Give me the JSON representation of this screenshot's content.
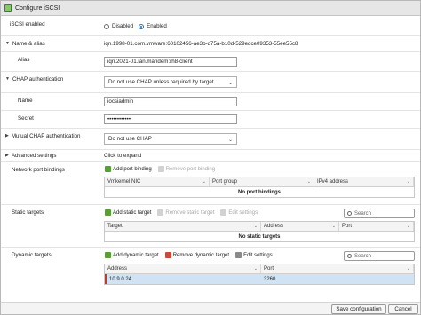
{
  "window": {
    "title": "Configure iSCSI"
  },
  "iscsi_enabled": {
    "label": "iSCSI enabled",
    "option_disabled": "Disabled",
    "option_enabled": "Enabled",
    "selected": "Enabled"
  },
  "name_alias": {
    "label": "Name & alias",
    "iqn": "iqn.1998-01.com.vmware:60102456-ae3b-d75a-b10d-529edce09353-55ee55c8"
  },
  "alias": {
    "label": "Alias",
    "value": "iqn.2021-01.lan.mandem:rh8-client"
  },
  "chap": {
    "label": "CHAP authentication",
    "value": "Do not use CHAP unless required by target"
  },
  "chap_name": {
    "label": "Name",
    "value": "iocsiadmin"
  },
  "chap_secret": {
    "label": "Secret",
    "value": "••••••••••••"
  },
  "mutual_chap": {
    "label": "Mutual CHAP authentication",
    "value": "Do not use CHAP"
  },
  "advanced": {
    "label": "Advanced settings",
    "value": "Click to expand"
  },
  "port_bindings": {
    "label": "Network port bindings",
    "add": "Add port binding",
    "remove": "Remove port binding",
    "columns": [
      "Vmkernel NIC",
      "Port group",
      "IPv4 address"
    ],
    "empty": "No port bindings"
  },
  "static_targets": {
    "label": "Static targets",
    "add": "Add static target",
    "remove": "Remove static target",
    "edit": "Edit settings",
    "search_placeholder": "Search",
    "columns": [
      "Target",
      "Address",
      "Port"
    ],
    "empty": "No static targets"
  },
  "dynamic_targets": {
    "label": "Dynamic targets",
    "add": "Add dynamic target",
    "remove": "Remove dynamic target",
    "edit": "Edit settings",
    "search_placeholder": "Search",
    "columns": [
      "Address",
      "Port"
    ],
    "rows": [
      {
        "address": "10.9.0.24",
        "port": "3260"
      }
    ]
  },
  "footer": {
    "save": "Save configuration",
    "cancel": "Cancel"
  },
  "colors": {
    "accent": "#1f6fb5",
    "selected_row": "#cfe3f4",
    "add_icon": "#5a9e3a",
    "remove_icon": "#c74a3a"
  }
}
